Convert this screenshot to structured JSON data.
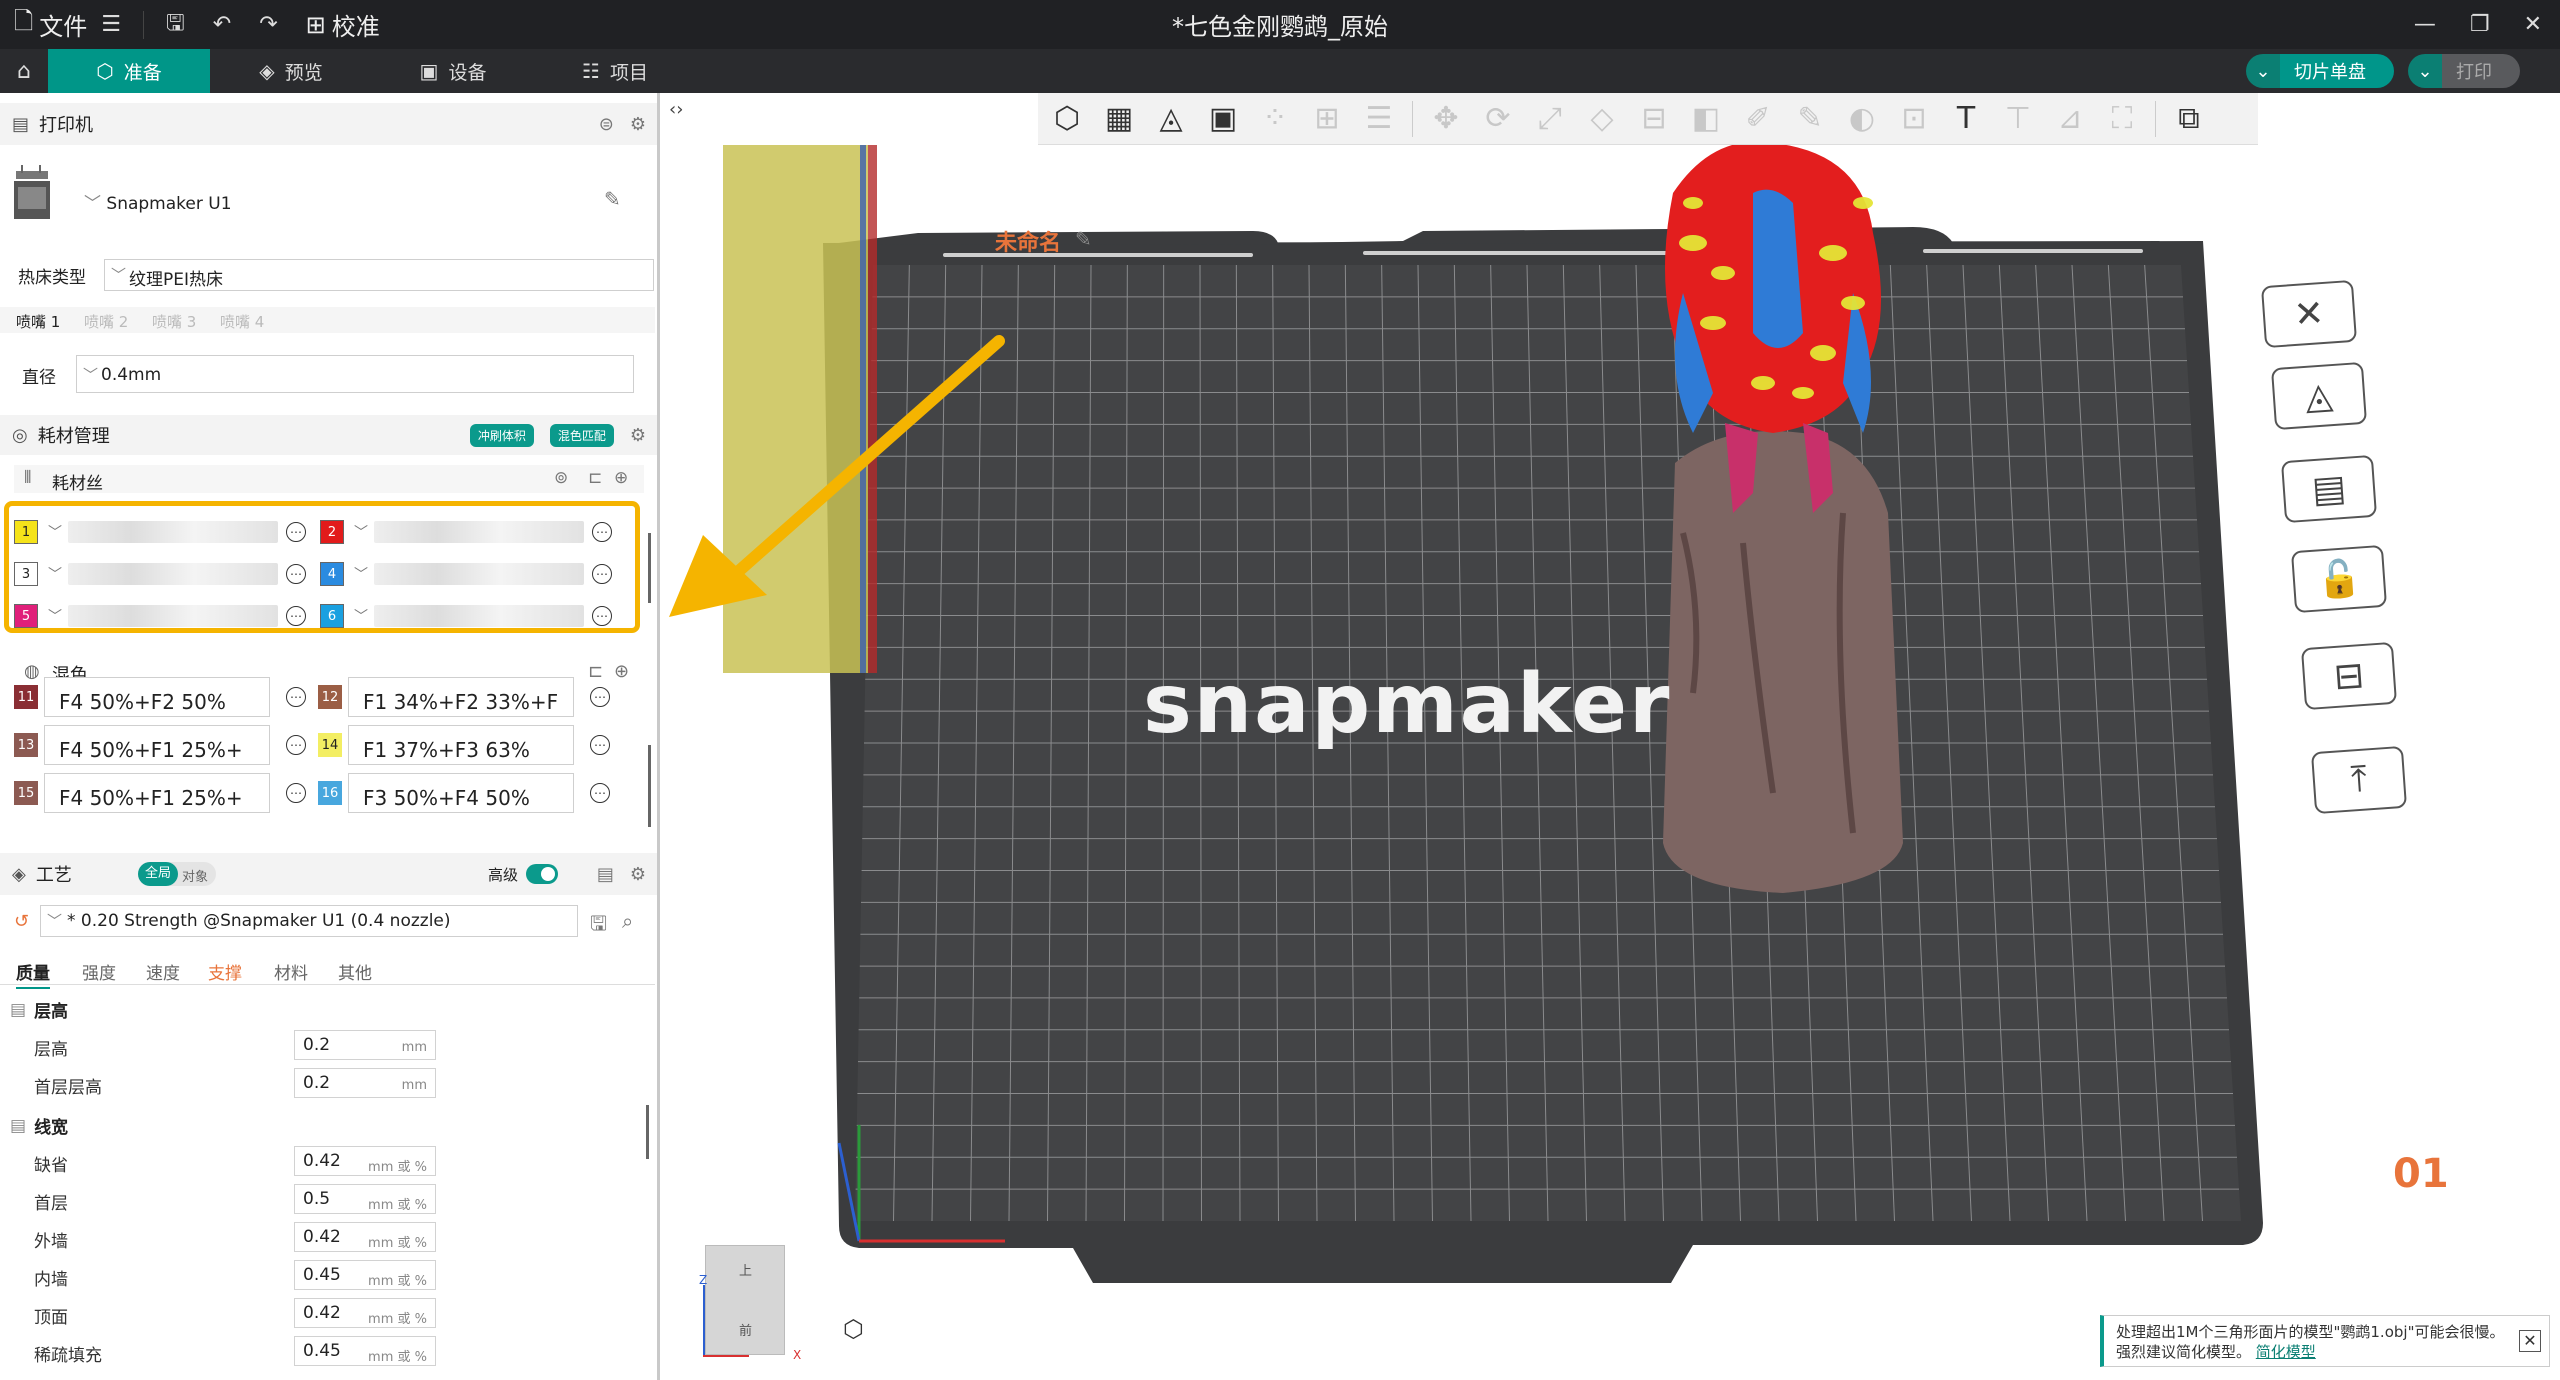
{
  "titlebar": {
    "file_label": "文件",
    "calibrate_label": "校准",
    "window_title": "*七色金刚鹦鹉_原始"
  },
  "tabs": [
    {
      "label": "准备",
      "active": true
    },
    {
      "label": "预览",
      "active": false
    },
    {
      "label": "设备",
      "active": false
    },
    {
      "label": "项目",
      "active": false
    }
  ],
  "actions": {
    "slice_label": "切片单盘",
    "print_label": "打印"
  },
  "printer": {
    "section_title": "打印机",
    "name": "Snapmaker U1",
    "bed_type_label": "热床类型",
    "bed_type_value": "纹理PEI热床",
    "nozzle_tabs": [
      "喷嘴 1",
      "喷嘴 2",
      "喷嘴 3",
      "喷嘴 4"
    ],
    "diameter_label": "直径",
    "diameter_value": "0.4mm"
  },
  "filament": {
    "section_title": "耗材管理",
    "tag_flush": "冲刷体积",
    "tag_mix": "混色匹配",
    "sub_title": "耗材丝",
    "slots": [
      {
        "num": "1",
        "color": "#f5e31a",
        "text_color": "#222"
      },
      {
        "num": "2",
        "color": "#e21b1b",
        "text_color": "#fff"
      },
      {
        "num": "3",
        "color": "#ffffff",
        "text_color": "#222"
      },
      {
        "num": "4",
        "color": "#2a8be0",
        "text_color": "#fff"
      },
      {
        "num": "5",
        "color": "#e0207a",
        "text_color": "#fff"
      },
      {
        "num": "6",
        "color": "#1aa0e0",
        "text_color": "#fff"
      }
    ],
    "mix_title": "混色",
    "mixes": [
      {
        "num": "11",
        "color": "#8a2e34",
        "text": "F4 50%+F2 50%"
      },
      {
        "num": "12",
        "color": "#9b5e45",
        "text": "F1 34%+F2 33%+F"
      },
      {
        "num": "13",
        "color": "#8c5a52",
        "text": "F4 50%+F1 25%+"
      },
      {
        "num": "14",
        "color": "#f3ee63",
        "text": "F1 37%+F3 63%"
      },
      {
        "num": "15",
        "color": "#8c5a52",
        "text": "F4 50%+F1 25%+"
      },
      {
        "num": "16",
        "color": "#48a7de",
        "text": "F3 50%+F4 50%"
      }
    ]
  },
  "process": {
    "section_title": "工艺",
    "toggle_global": "全局",
    "toggle_object": "对象",
    "advanced_label": "高级",
    "preset": "* 0.20 Strength @Snapmaker U1 (0.4 nozzle)",
    "tabs": [
      "质量",
      "强度",
      "速度",
      "支撑",
      "材料",
      "其他"
    ],
    "groups": [
      {
        "title": "层高",
        "rows": [
          {
            "label": "层高",
            "value": "0.2",
            "unit": "mm"
          },
          {
            "label": "首层层高",
            "value": "0.2",
            "unit": "mm"
          }
        ]
      },
      {
        "title": "线宽",
        "rows": [
          {
            "label": "缺省",
            "value": "0.42",
            "unit": "mm 或 %"
          },
          {
            "label": "首层",
            "value": "0.5",
            "unit": "mm 或 %"
          },
          {
            "label": "外墙",
            "value": "0.42",
            "unit": "mm 或 %"
          },
          {
            "label": "内墙",
            "value": "0.45",
            "unit": "mm 或 %"
          },
          {
            "label": "顶面",
            "value": "0.42",
            "unit": "mm 或 %"
          },
          {
            "label": "稀疏填充",
            "value": "0.45",
            "unit": "mm 或 %"
          }
        ]
      }
    ]
  },
  "viewport": {
    "plate_name": "未命名",
    "plate_number": "01",
    "bed_logo": "snapmaker",
    "cube_top": "上",
    "cube_front": "前",
    "axis_z": "Z",
    "axis_x": "X"
  },
  "notice": {
    "text": "处理超出1M个三角形面片的模型\"鹦鹉1.obj\"可能会很慢。强烈建议简化模型。",
    "link": "简化模型"
  },
  "colors": {
    "accent": "#00968a",
    "highlight": "#f5b400",
    "arrow": "#f5b400"
  }
}
